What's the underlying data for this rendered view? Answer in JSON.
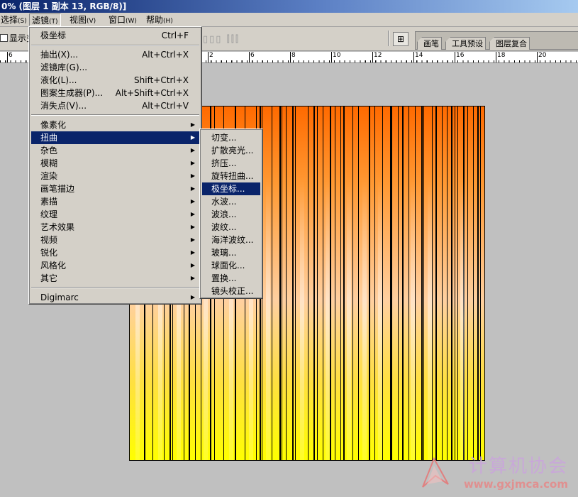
{
  "window": {
    "title": "0% (图层 1 副本 13, RGB/8)]"
  },
  "menubar": [
    {
      "label": "选择",
      "accel": "(S)"
    },
    {
      "label": "滤镜",
      "accel": "(T)"
    },
    {
      "label": "视图",
      "accel": "(V)"
    },
    {
      "label": "窗口",
      "accel": "(W)"
    },
    {
      "label": "帮助",
      "accel": "(H)"
    }
  ],
  "toolbar": {
    "show_label": "显示变",
    "align_icons": "▯▯▯ ⫿⫿⫿",
    "palette_icon": "⊞",
    "tabs": [
      "画笔",
      "工具预设",
      "图层复合"
    ]
  },
  "ruler": {
    "labels": [
      "6",
      "2",
      "6",
      "8",
      "10",
      "12",
      "14",
      "16",
      "18",
      "20"
    ]
  },
  "filter_menu": {
    "last_filter": {
      "label": "极坐标",
      "shortcut": "Ctrl+F"
    },
    "group1": [
      {
        "label": "抽出(X)...",
        "shortcut": "Alt+Ctrl+X"
      },
      {
        "label": "滤镜库(G)...",
        "shortcut": ""
      },
      {
        "label": "液化(L)...",
        "shortcut": "Shift+Ctrl+X"
      },
      {
        "label": "图案生成器(P)...",
        "shortcut": "Alt+Shift+Ctrl+X"
      },
      {
        "label": "消失点(V)...",
        "shortcut": "Alt+Ctrl+V"
      }
    ],
    "submenus": [
      "像素化",
      "扭曲",
      "杂色",
      "模糊",
      "渲染",
      "画笔描边",
      "素描",
      "纹理",
      "艺术效果",
      "视频",
      "锐化",
      "风格化",
      "其它"
    ],
    "selected_submenu": "扭曲",
    "digimarc": "Digimarc"
  },
  "distort_submenu": {
    "items": [
      "切变...",
      "扩散亮光...",
      "挤压...",
      "旋转扭曲...",
      "极坐标...",
      "水波...",
      "波浪...",
      "波纹...",
      "海洋波纹...",
      "玻璃...",
      "球面化...",
      "置换...",
      "镜头校正..."
    ],
    "selected": "极坐标..."
  },
  "canvas": {
    "gradient_top": "#ff6a00",
    "gradient_bottom": "#ffff00",
    "stripe_color": "#000000"
  },
  "watermark": {
    "text": "计算机协会",
    "url": "www.gxjmca.com"
  }
}
